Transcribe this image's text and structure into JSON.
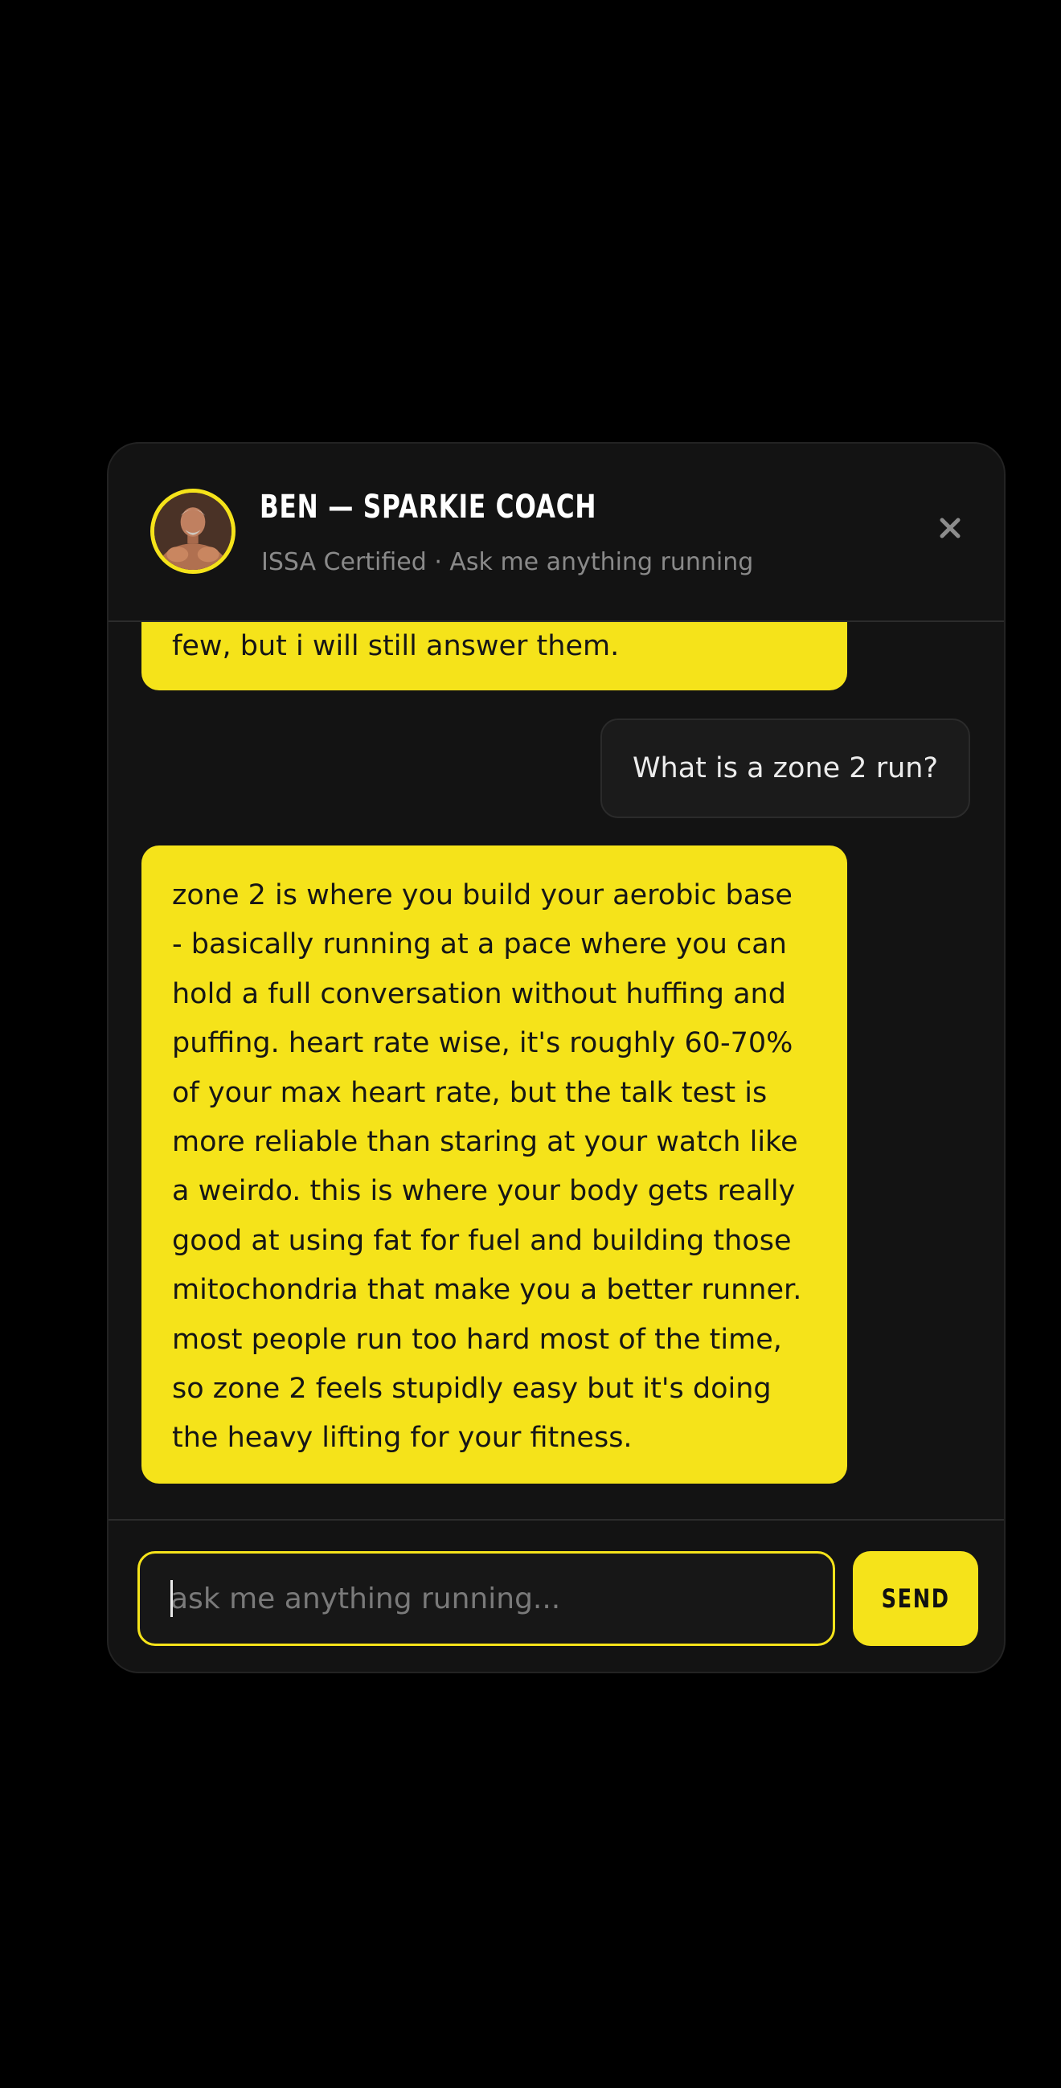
{
  "header": {
    "coach_name": "BEN — SPARKIE COACH",
    "subtitle": "ISSA Certified · Ask me anything running",
    "close_icon": "close-icon"
  },
  "messages": [
    {
      "role": "bot",
      "text": "few, but i will still answer them."
    },
    {
      "role": "user",
      "text": "What is a zone 2 run?"
    },
    {
      "role": "bot",
      "text": "zone 2 is where you build your aerobic base\n- basically running at a pace where you can\nhold a full conversation without huffing and\npuffing. heart rate wise, it's roughly 60-70%\nof your max heart rate, but the talk test is\nmore reliable than staring at your watch like\na weirdo. this is where your body gets really\ngood at using fat for fuel and building those\nmitochondria that make you a better runner.\nmost people run too hard most of the time,\nso zone 2 feels stupidly easy but it's doing\nthe heavy lifting for your fitness."
    }
  ],
  "composer": {
    "value": "",
    "placeholder": "ask me anything running...",
    "send_label": "SEND"
  },
  "colors": {
    "accent": "#f5e31a",
    "panel": "#131313",
    "background": "#000000"
  }
}
